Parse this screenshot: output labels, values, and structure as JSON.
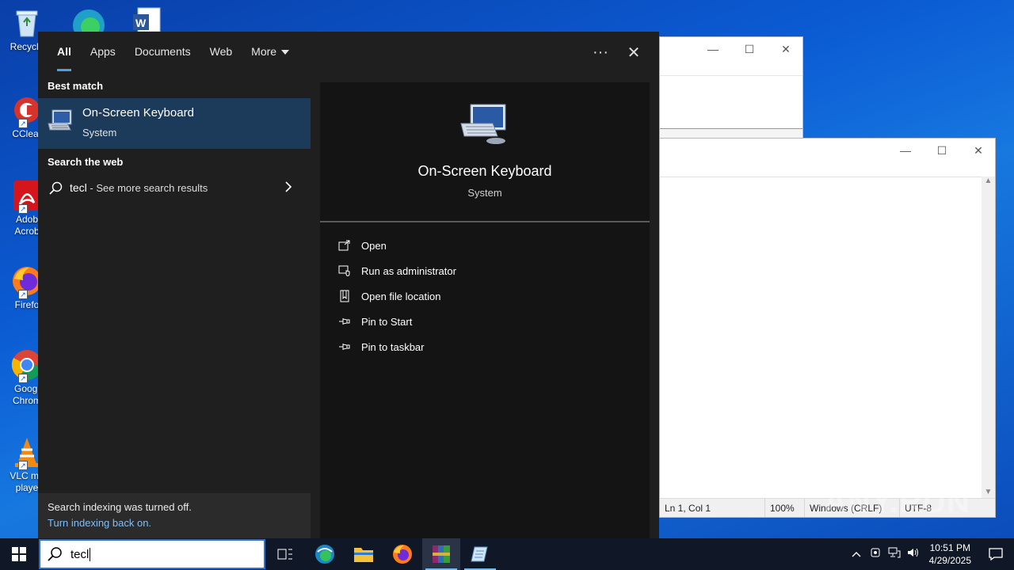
{
  "desktop": {
    "icons": [
      {
        "label": "Recycle",
        "icon": "recycle-bin-icon"
      },
      {
        "label": "CClear",
        "icon": "ccleaner-icon"
      },
      {
        "label": "Adob Acrob",
        "icon": "acrobat-icon"
      },
      {
        "label": "Firefo",
        "icon": "firefox-icon"
      },
      {
        "label": "Googl Chrom",
        "icon": "chrome-icon"
      },
      {
        "label": "VLC me playe",
        "icon": "vlc-icon"
      }
    ]
  },
  "notepad": {
    "status": {
      "position": "Ln 1, Col 1",
      "zoom": "100%",
      "line_ending": "Windows (CRLF)",
      "encoding": "UTF-8"
    }
  },
  "search_panel": {
    "tabs": [
      {
        "label": "All",
        "active": true
      },
      {
        "label": "Apps"
      },
      {
        "label": "Documents"
      },
      {
        "label": "Web"
      },
      {
        "label": "More"
      }
    ],
    "more_options": "···",
    "close": "✕",
    "best_match_heading": "Best match",
    "best_match": {
      "name": "On-Screen Keyboard",
      "type": "System"
    },
    "search_web_heading": "Search the web",
    "web_result": {
      "query": "tecl",
      "suffix": " - See more search results"
    },
    "indexing": {
      "message": "Search indexing was turned off.",
      "link": "Turn indexing back on."
    },
    "preview": {
      "name": "On-Screen Keyboard",
      "type": "System",
      "actions": [
        "Open",
        "Run as administrator",
        "Open file location",
        "Pin to Start",
        "Pin to taskbar"
      ]
    }
  },
  "taskbar": {
    "search_value": "tecl",
    "clock": {
      "time": "10:51 PM",
      "date": "4/29/2025"
    }
  },
  "watermark": "ANY.RUN"
}
